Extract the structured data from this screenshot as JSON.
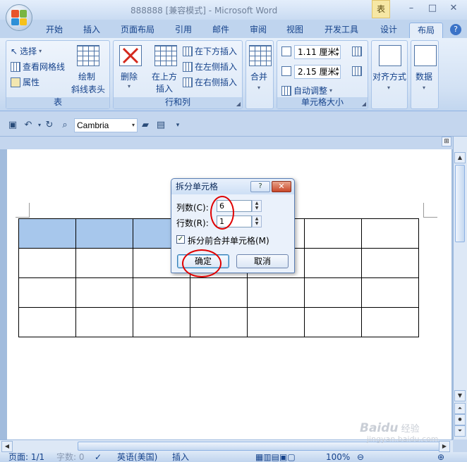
{
  "app": {
    "title": "888888 [兼容模式] - Microsoft Word",
    "context_tab_label": "表",
    "window_controls": [
      "–",
      "□",
      "✕"
    ]
  },
  "ribbon_tabs": [
    "开始",
    "插入",
    "页面布局",
    "引用",
    "邮件",
    "审阅",
    "视图",
    "开发工具",
    "设计",
    "布局"
  ],
  "active_tab": "布局",
  "ribbon": {
    "table_group": {
      "label": "表",
      "select": "选择",
      "view_gridlines": "查看网格线",
      "properties": "属性",
      "draw_diagonal_line1": "绘制",
      "draw_diagonal_line2": "斜线表头"
    },
    "rows_cols_group": {
      "label": "行和列",
      "delete": "删除",
      "insert_above_1": "在上方",
      "insert_above_2": "插入",
      "insert_below": "在下方插入",
      "insert_left": "在左侧插入",
      "insert_right": "在右侧插入"
    },
    "merge_group": {
      "label": "合并"
    },
    "cell_size_group": {
      "label": "单元格大小",
      "height_value": "1.11 厘米",
      "width_value": "2.15 厘米",
      "autofit": "自动调整"
    },
    "align_group": {
      "label": "对齐方式"
    },
    "data_group": {
      "label": "数据"
    }
  },
  "qat": {
    "font_name": "Cambria"
  },
  "dialog": {
    "title": "拆分单元格",
    "help_button": "?",
    "close_button": "✕",
    "columns_label": "列数(C):",
    "columns_value": "6",
    "rows_label": "行数(R):",
    "rows_value": "1",
    "merge_before_split_label": "拆分前合并单元格(M)",
    "merge_before_split_checked": true,
    "ok_label": "确定",
    "cancel_label": "取消"
  },
  "document": {
    "table": {
      "rows": 4,
      "cols": 7,
      "selected_cells_row1": 3,
      "selection_color": "#a7c7ec"
    }
  },
  "status_bar": {
    "page": "页面: 1/1",
    "words": "字数: 0",
    "language": "英语(美国)",
    "insert_mode": "插入",
    "zoom": "100%"
  },
  "watermark": {
    "brand": "Baidu",
    "suffix": "经验",
    "url": "jingyan.baidu.com"
  },
  "colors": {
    "ribbon": "#d2e1f4",
    "accent": "#15428b",
    "annotation": "#e00000"
  }
}
